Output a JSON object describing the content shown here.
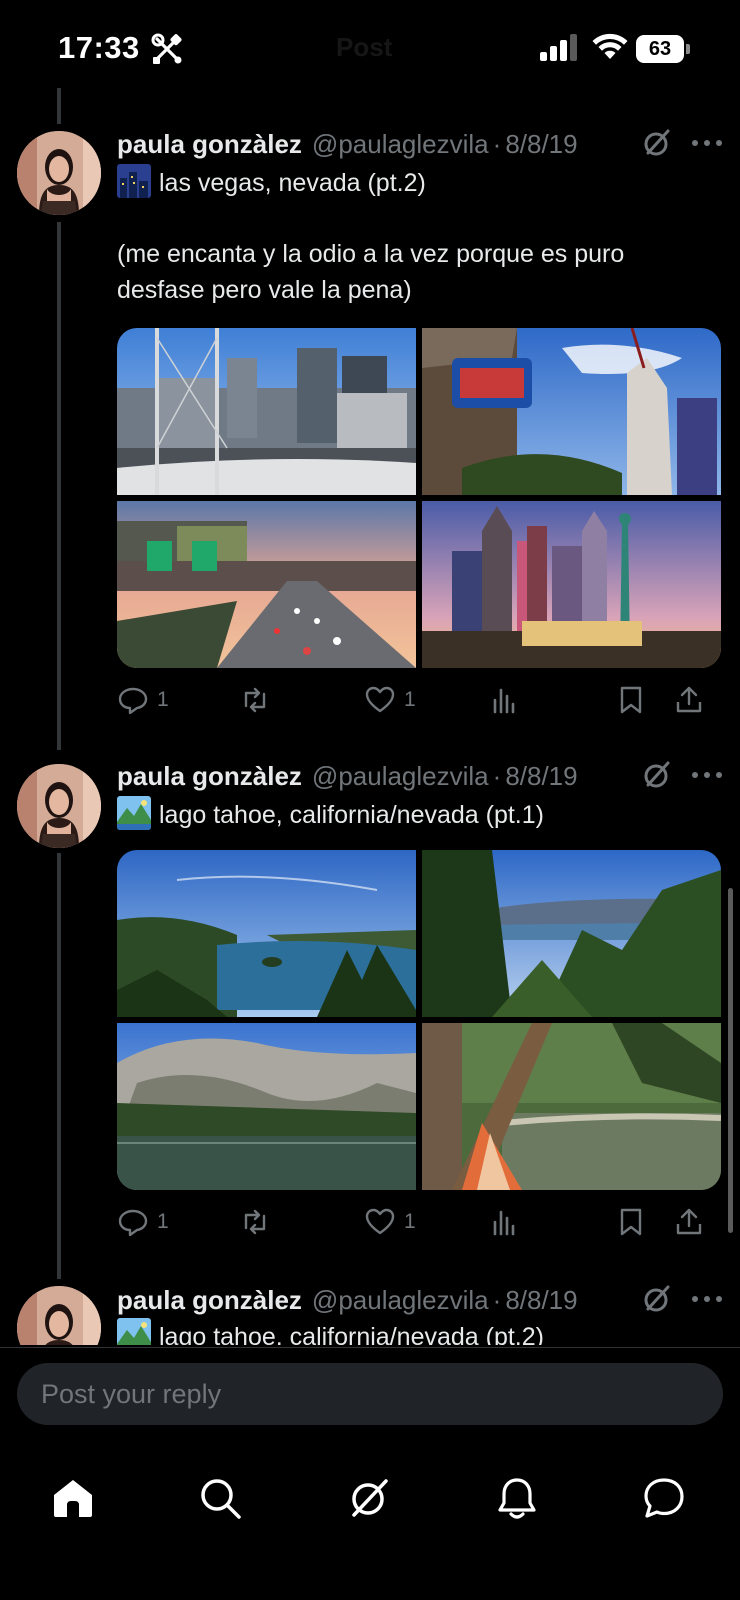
{
  "status_bar": {
    "time": "17:33",
    "faded_title": "Post",
    "battery": "63",
    "icons": [
      "tools-icon",
      "cellular-signal-icon",
      "wifi-icon",
      "battery-icon"
    ]
  },
  "posts": [
    {
      "display_name": "paula gonzàlez",
      "handle": "@paulaglezvila",
      "separator": "·",
      "date": "8/8/19",
      "emoji": "night-city-emoji",
      "title": "las vegas, nevada (pt.2)",
      "body": "(me encanta y la odio a la vez porque es puro desfase pero vale la pena)",
      "photos": [
        "las-vegas-skyline-photo",
        "new-york-new-york-sign-photo",
        "las-vegas-strip-sunset-photo",
        "new-york-new-york-hotel-photo"
      ],
      "replies": "1",
      "reposts": "",
      "likes": "1"
    },
    {
      "display_name": "paula gonzàlez",
      "handle": "@paulaglezvila",
      "separator": "·",
      "date": "8/8/19",
      "emoji": "national-park-emoji",
      "title": "lago tahoe, california/nevada (pt.1)",
      "body": "",
      "photos": [
        "emerald-bay-photo",
        "pine-forest-lake-view-photo",
        "granite-mountain-lake-photo",
        "hammock-by-lake-photo"
      ],
      "replies": "1",
      "reposts": "",
      "likes": "1"
    },
    {
      "display_name": "paula gonzàlez",
      "handle": "@paulaglezvila",
      "separator": "·",
      "date": "8/8/19",
      "emoji": "national-park-emoji",
      "title": "lago tahoe, california/nevada (pt.2)"
    }
  ],
  "reply_bar": {
    "placeholder": "Post your reply"
  },
  "bottom_nav": {
    "items": [
      "home",
      "search",
      "grok",
      "notifications",
      "messages"
    ],
    "active": "home"
  },
  "colors": {
    "background": "#000000",
    "text_primary": "#e7e9ea",
    "text_secondary": "#71767b",
    "thread_line": "#333639",
    "input_bg": "#202327"
  }
}
